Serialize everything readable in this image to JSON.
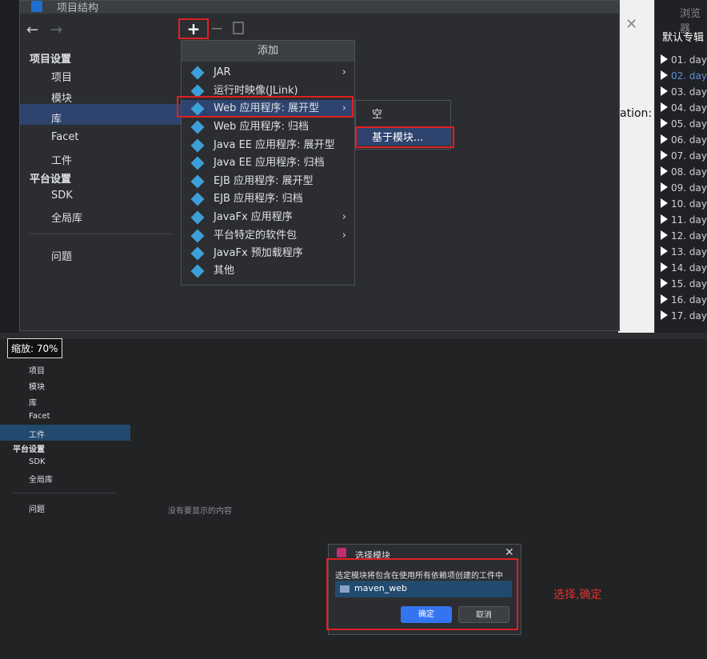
{
  "top_dialog": {
    "title": "项目结构",
    "sidebar": {
      "project_settings_header": "项目设置",
      "items": [
        "项目",
        "模块",
        "库",
        "Facet",
        "工件"
      ],
      "platform_settings_header": "平台设置",
      "platform_items": [
        "SDK",
        "全局库"
      ],
      "problems": "问题"
    },
    "toolbar": {
      "add": "+",
      "remove": "−"
    }
  },
  "add_menu": {
    "header": "添加",
    "items": [
      {
        "label": "JAR",
        "submenu": true
      },
      {
        "label": "运行时映像(JLink)",
        "submenu": false
      },
      {
        "label": "Web 应用程序: 展开型",
        "submenu": true
      },
      {
        "label": "Web 应用程序: 归档",
        "submenu": false
      },
      {
        "label": "Java EE 应用程序: 展开型",
        "submenu": false
      },
      {
        "label": "Java EE 应用程序: 归档",
        "submenu": false
      },
      {
        "label": "EJB 应用程序: 展开型",
        "submenu": false
      },
      {
        "label": "EJB 应用程序: 归档",
        "submenu": false
      },
      {
        "label": "JavaFx 应用程序",
        "submenu": true
      },
      {
        "label": "平台特定的软件包",
        "submenu": true
      },
      {
        "label": "JavaFx 预加载程序",
        "submenu": false
      },
      {
        "label": "其他",
        "submenu": false
      }
    ],
    "chevron": "›"
  },
  "sub_menu": {
    "empty": "空",
    "from_module": "基于模块..."
  },
  "background": {
    "partial_text": "ation: E",
    "right_panel_title": "默认专辑",
    "browse": "浏览器",
    "playlist": [
      "01. day",
      "02. day",
      "03. day",
      "04. day",
      "05. day",
      "06. day",
      "07. day",
      "08. day",
      "09. day",
      "10. day",
      "11. day",
      "12. day",
      "13. day",
      "14. day",
      "15. day",
      "16. day",
      "17. day"
    ]
  },
  "bottom": {
    "zoom": "缩放: 70%",
    "sidebar": {
      "items": [
        "项目",
        "模块",
        "库",
        "Facet",
        "工件"
      ],
      "platform_settings_header": "平台设置",
      "platform_items": [
        "SDK",
        "全局库"
      ],
      "problems": "问题"
    },
    "empty_message": "没有要显示的内容"
  },
  "choose_dialog": {
    "title": "选择模块",
    "message": "选定模块将包含在使用所有依赖项创建的工件中",
    "module": "maven_web",
    "ok": "确定",
    "cancel": "取消"
  },
  "annotation": "选择,确定",
  "colors": {
    "selection": "#2e436e",
    "highlight_border": "#e02020",
    "accent": "#3574f0"
  }
}
